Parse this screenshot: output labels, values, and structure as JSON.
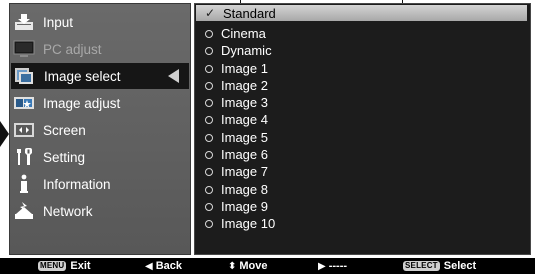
{
  "menu": {
    "items": [
      {
        "label": "Input",
        "icon": "input-icon",
        "dim": false
      },
      {
        "label": "PC adjust",
        "icon": "pc-adjust-icon",
        "dim": true
      },
      {
        "label": "Image select",
        "icon": "image-select-icon",
        "dim": false,
        "selected": true
      },
      {
        "label": "Image adjust",
        "icon": "image-adjust-icon",
        "dim": false
      },
      {
        "label": "Screen",
        "icon": "screen-icon",
        "dim": false
      },
      {
        "label": "Setting",
        "icon": "setting-icon",
        "dim": false
      },
      {
        "label": "Information",
        "icon": "information-icon",
        "dim": false
      },
      {
        "label": "Network",
        "icon": "network-icon",
        "dim": false
      }
    ]
  },
  "options": {
    "items": [
      {
        "label": "Standard",
        "selected": true
      },
      {
        "label": "Cinema"
      },
      {
        "label": "Dynamic"
      },
      {
        "label": "Image 1"
      },
      {
        "label": "Image 2"
      },
      {
        "label": "Image 3"
      },
      {
        "label": "Image 4"
      },
      {
        "label": "Image 5"
      },
      {
        "label": "Image 6"
      },
      {
        "label": "Image 7"
      },
      {
        "label": "Image 8"
      },
      {
        "label": "Image 9"
      },
      {
        "label": "Image 10"
      }
    ]
  },
  "bottom_bar": {
    "exit_key": "MENU",
    "exit_label": "Exit",
    "back_label": "Back",
    "move_label": "Move",
    "next_label": "-----",
    "select_key": "SELECT",
    "select_label": "Select"
  },
  "colors": {
    "panel_bg": "#5e5e5e",
    "selected_row": "#161616",
    "highlight": "#c0c0c0"
  }
}
